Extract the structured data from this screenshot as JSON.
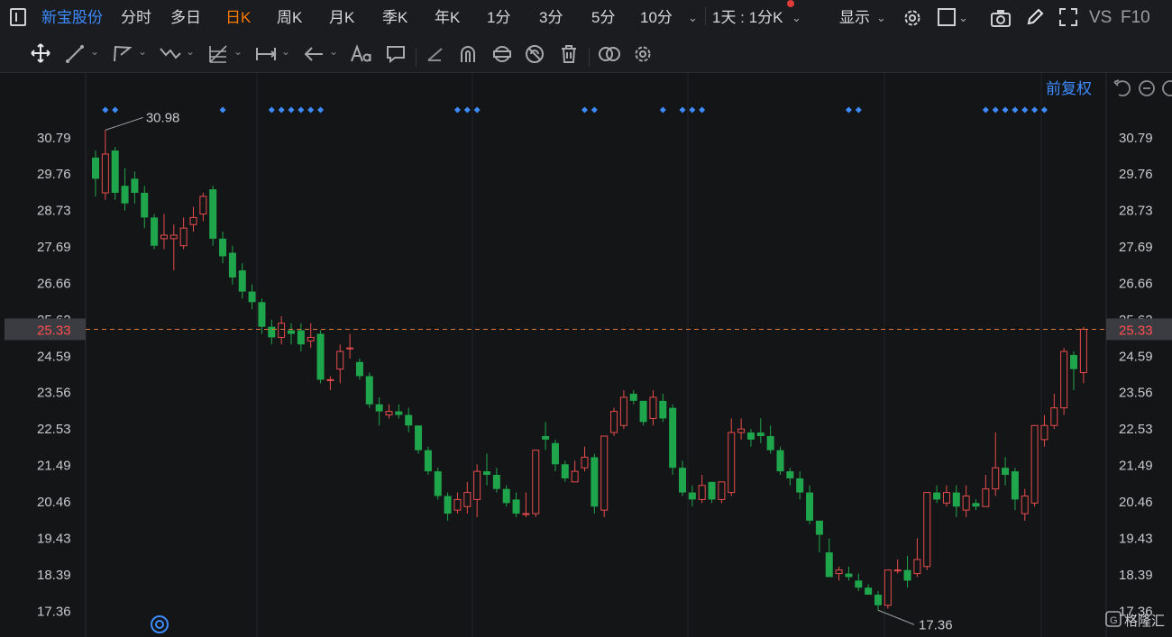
{
  "toolbar": {
    "stock_name": "新宝股份",
    "periods": [
      "分时",
      "多日",
      "日K",
      "周K",
      "月K",
      "季K",
      "年K",
      "1分",
      "3分",
      "5分",
      "10分"
    ],
    "active_period": "日K",
    "interval_label": "1天 : 1分K",
    "display_label": "显示",
    "vs_label": "VS",
    "f10_label": "F10"
  },
  "chart_header": {
    "adjust_label": "前复权"
  },
  "colors": {
    "up": "#e74c4c",
    "down": "#1fa64c",
    "accent": "#3d8bfd",
    "active": "#ff7a00",
    "crosshair": "#e07a3c"
  },
  "chart_data": {
    "type": "candlestick",
    "y_ticks": [
      30.79,
      29.76,
      28.73,
      27.69,
      26.66,
      25.62,
      24.59,
      23.56,
      22.53,
      21.49,
      20.46,
      19.43,
      18.39,
      17.36
    ],
    "ylim": [
      16.6,
      32.6
    ],
    "high_label": "30.98",
    "low_label": "17.36",
    "crosshair_value": "25.33",
    "ohlc": [
      [
        30.2,
        29.6,
        30.4,
        29.1
      ],
      [
        29.2,
        30.3,
        30.98,
        29.0
      ],
      [
        30.4,
        29.2,
        30.5,
        29.0
      ],
      [
        29.4,
        28.9,
        29.9,
        28.7
      ],
      [
        29.6,
        29.2,
        29.8,
        28.9
      ],
      [
        29.2,
        28.5,
        29.4,
        28.2
      ],
      [
        28.5,
        27.7,
        28.6,
        27.6
      ],
      [
        27.9,
        28.0,
        28.6,
        27.6
      ],
      [
        27.9,
        28.0,
        28.3,
        27.0
      ],
      [
        27.7,
        28.2,
        28.5,
        27.6
      ],
      [
        28.3,
        28.5,
        28.8,
        28.1
      ],
      [
        28.6,
        29.1,
        29.2,
        28.4
      ],
      [
        29.3,
        27.9,
        29.4,
        27.7
      ],
      [
        27.9,
        27.4,
        28.1,
        27.2
      ],
      [
        27.5,
        26.8,
        27.7,
        26.6
      ],
      [
        27.0,
        26.4,
        27.2,
        26.2
      ],
      [
        26.4,
        26.1,
        26.6,
        25.9
      ],
      [
        26.1,
        25.4,
        26.2,
        25.2
      ],
      [
        25.4,
        25.1,
        25.6,
        24.9
      ],
      [
        25.1,
        25.5,
        25.7,
        24.9
      ],
      [
        25.3,
        25.2,
        25.5,
        24.9
      ],
      [
        25.3,
        24.9,
        25.5,
        24.7
      ],
      [
        25.0,
        25.1,
        25.5,
        24.8
      ],
      [
        25.2,
        23.9,
        25.3,
        23.8
      ],
      [
        23.9,
        23.9,
        24.0,
        23.6
      ],
      [
        24.2,
        24.7,
        24.9,
        23.8
      ],
      [
        24.8,
        24.8,
        25.2,
        24.5
      ],
      [
        24.4,
        24.0,
        24.5,
        23.9
      ],
      [
        24.0,
        23.2,
        24.1,
        23.1
      ],
      [
        23.2,
        23.0,
        23.4,
        22.6
      ],
      [
        22.9,
        23.0,
        23.2,
        22.8
      ],
      [
        23.0,
        22.9,
        23.2,
        22.8
      ],
      [
        22.9,
        22.6,
        23.1,
        22.4
      ],
      [
        22.6,
        21.9,
        22.6,
        21.8
      ],
      [
        21.9,
        21.3,
        22.0,
        21.2
      ],
      [
        21.3,
        20.6,
        21.4,
        20.5
      ],
      [
        20.6,
        20.1,
        20.7,
        19.9
      ],
      [
        20.2,
        20.5,
        20.7,
        20.1
      ],
      [
        20.3,
        20.7,
        21.0,
        20.1
      ],
      [
        20.5,
        21.3,
        21.5,
        20.0
      ],
      [
        21.3,
        21.2,
        21.8,
        20.9
      ],
      [
        21.2,
        20.8,
        21.4,
        20.7
      ],
      [
        20.8,
        20.4,
        20.9,
        20.3
      ],
      [
        20.5,
        20.1,
        20.7,
        20.0
      ],
      [
        20.1,
        20.1,
        20.7,
        20.0
      ],
      [
        20.1,
        21.9,
        21.9,
        20.0
      ],
      [
        22.3,
        22.2,
        22.7,
        21.9
      ],
      [
        22.1,
        21.5,
        22.2,
        21.3
      ],
      [
        21.5,
        21.1,
        21.6,
        21.0
      ],
      [
        21.0,
        21.3,
        21.6,
        21.0
      ],
      [
        21.4,
        21.7,
        22.0,
        21.3
      ],
      [
        21.7,
        20.3,
        21.8,
        20.1
      ],
      [
        20.2,
        22.3,
        22.3,
        20.0
      ],
      [
        22.4,
        23.0,
        23.1,
        22.3
      ],
      [
        22.6,
        23.4,
        23.6,
        22.5
      ],
      [
        23.5,
        23.3,
        23.6,
        23.2
      ],
      [
        23.3,
        22.7,
        23.3,
        22.6
      ],
      [
        22.8,
        23.4,
        23.6,
        22.6
      ],
      [
        23.3,
        22.8,
        23.5,
        22.7
      ],
      [
        23.1,
        21.4,
        23.2,
        21.2
      ],
      [
        21.4,
        20.7,
        21.6,
        20.6
      ],
      [
        20.7,
        20.5,
        20.9,
        20.3
      ],
      [
        20.5,
        20.9,
        21.2,
        20.4
      ],
      [
        21.0,
        20.5,
        21.0,
        20.4
      ],
      [
        20.5,
        21.0,
        21.0,
        20.4
      ],
      [
        20.7,
        22.4,
        22.8,
        20.6
      ],
      [
        22.4,
        22.5,
        22.8,
        22.2
      ],
      [
        22.4,
        22.2,
        22.5,
        22.0
      ],
      [
        22.4,
        22.3,
        22.8,
        22.1
      ],
      [
        22.3,
        21.9,
        22.6,
        21.8
      ],
      [
        21.9,
        21.3,
        22.0,
        21.2
      ],
      [
        21.3,
        21.1,
        21.4,
        20.9
      ],
      [
        21.1,
        20.7,
        21.3,
        20.5
      ],
      [
        20.7,
        19.9,
        20.9,
        19.8
      ],
      [
        19.9,
        19.5,
        19.9,
        19.0
      ],
      [
        19.0,
        18.3,
        19.4,
        18.3
      ],
      [
        18.4,
        18.5,
        18.6,
        18.2
      ],
      [
        18.4,
        18.3,
        18.6,
        18.2
      ],
      [
        18.2,
        18.0,
        18.4,
        17.9
      ],
      [
        18.0,
        17.8,
        18.1,
        17.8
      ],
      [
        17.8,
        17.5,
        17.9,
        17.36
      ],
      [
        17.5,
        18.5,
        18.5,
        17.4
      ],
      [
        18.5,
        18.5,
        18.8,
        18.4
      ],
      [
        18.5,
        18.2,
        18.9,
        18.0
      ],
      [
        18.4,
        18.8,
        19.4,
        18.3
      ],
      [
        18.6,
        20.7,
        20.7,
        18.5
      ],
      [
        20.7,
        20.5,
        20.9,
        20.4
      ],
      [
        20.4,
        20.7,
        20.9,
        20.3
      ],
      [
        20.7,
        20.3,
        20.9,
        20.0
      ],
      [
        20.2,
        20.6,
        20.9,
        20.0
      ],
      [
        20.4,
        20.3,
        20.5,
        20.2
      ],
      [
        20.3,
        20.8,
        21.2,
        20.3
      ],
      [
        20.8,
        21.4,
        22.4,
        20.6
      ],
      [
        21.4,
        21.2,
        21.7,
        20.9
      ],
      [
        21.3,
        20.5,
        21.4,
        20.2
      ],
      [
        20.1,
        20.6,
        20.8,
        19.9
      ],
      [
        20.4,
        22.6,
        22.6,
        20.3
      ],
      [
        22.2,
        22.6,
        22.9,
        22.0
      ],
      [
        22.6,
        23.1,
        23.5,
        22.5
      ],
      [
        23.1,
        24.7,
        24.8,
        22.9
      ],
      [
        24.6,
        24.2,
        24.7,
        23.6
      ],
      [
        24.1,
        25.33,
        25.4,
        23.8
      ]
    ],
    "markers": [
      1,
      2,
      13,
      18,
      19,
      20,
      21,
      22,
      23,
      37,
      38,
      39,
      50,
      51,
      58,
      60,
      61,
      62,
      77,
      78,
      91,
      92,
      93,
      94,
      95,
      96,
      97
    ]
  }
}
